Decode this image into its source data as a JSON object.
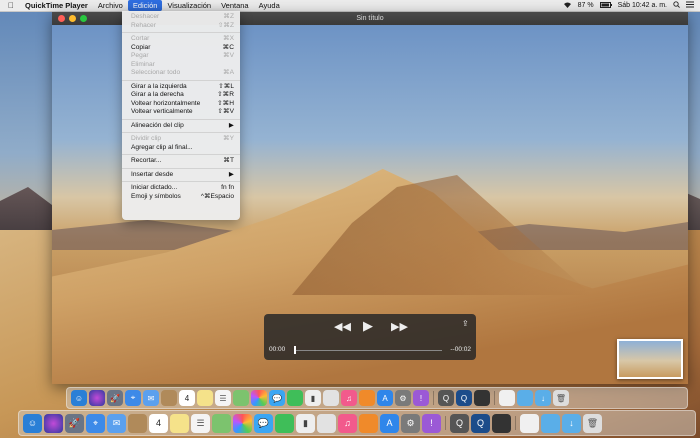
{
  "menubar": {
    "apple": "",
    "app_name": "QuickTime Player",
    "items": [
      "Archivo",
      "Edición",
      "Visualización",
      "Ventana",
      "Ayuda"
    ],
    "battery": "87 %",
    "datetime": "Sáb 10:42 a. m."
  },
  "window": {
    "title": "Sin título"
  },
  "edit_menu": {
    "undo": "Deshacer",
    "undo_sc": "⌘Z",
    "redo": "Rehacer",
    "redo_sc": "⇧⌘Z",
    "cut": "Cortar",
    "cut_sc": "⌘X",
    "copy": "Copiar",
    "copy_sc": "⌘C",
    "paste": "Pegar",
    "paste_sc": "⌘V",
    "delete": "Eliminar",
    "select_all": "Seleccionar todo",
    "select_all_sc": "⌘A",
    "rotate_left": "Girar a la izquierda",
    "rotate_left_sc": "⇧⌘L",
    "rotate_right": "Girar a la derecha",
    "rotate_right_sc": "⇧⌘R",
    "flip_h": "Voltear horizontalmente",
    "flip_h_sc": "⇧⌘H",
    "flip_v": "Voltear verticalmente",
    "flip_v_sc": "⇧⌘V",
    "clip_align": "Alineación del clip",
    "clip_align_sc": "▶",
    "split_clip": "Dividir clip",
    "split_clip_sc": "⌘Y",
    "add_clip_end": "Agregar clip al final...",
    "trim": "Recortar...",
    "trim_sc": "⌘T",
    "insert_from": "Insertar desde",
    "insert_from_sc": "▶",
    "dictation": "Iniciar dictado...",
    "dictation_sc": "fn fn",
    "emoji": "Emoji y símbolos",
    "emoji_sc": "^⌘Espacio"
  },
  "controls": {
    "current_time": "00:00",
    "remaining_time": "--00:02",
    "rewind": "◀◀",
    "play": "▶",
    "forward": "▶▶",
    "share": "⇪"
  },
  "dock_top": {
    "icons": [
      "finder-icon",
      "siri-icon",
      "launchpad-icon",
      "safari-icon",
      "mail-icon",
      "contacts-icon",
      "calendar-icon",
      "notes-icon",
      "reminders-icon",
      "maps-icon",
      "photos-icon",
      "messages-icon",
      "facetime-icon",
      "itunes-icon",
      "books-icon",
      "appstore-icon",
      "settings-icon",
      "downloads-icon",
      "quicktime-icon",
      "folder-icon",
      "trash-icon"
    ],
    "calendar_day": "4"
  },
  "dock_bottom": {
    "icons": [
      "finder-icon",
      "siri-icon",
      "launchpad-icon",
      "safari-icon",
      "mail-icon",
      "contacts-icon",
      "calendar-icon",
      "notes-icon",
      "reminders-icon",
      "maps-icon",
      "photos-icon",
      "messages-icon",
      "facetime-icon",
      "itunes-icon",
      "books-icon",
      "appstore-icon",
      "settings-icon",
      "downloads-icon",
      "quicktime-icon",
      "folder-icon",
      "trash-icon"
    ],
    "calendar_day": "4"
  }
}
